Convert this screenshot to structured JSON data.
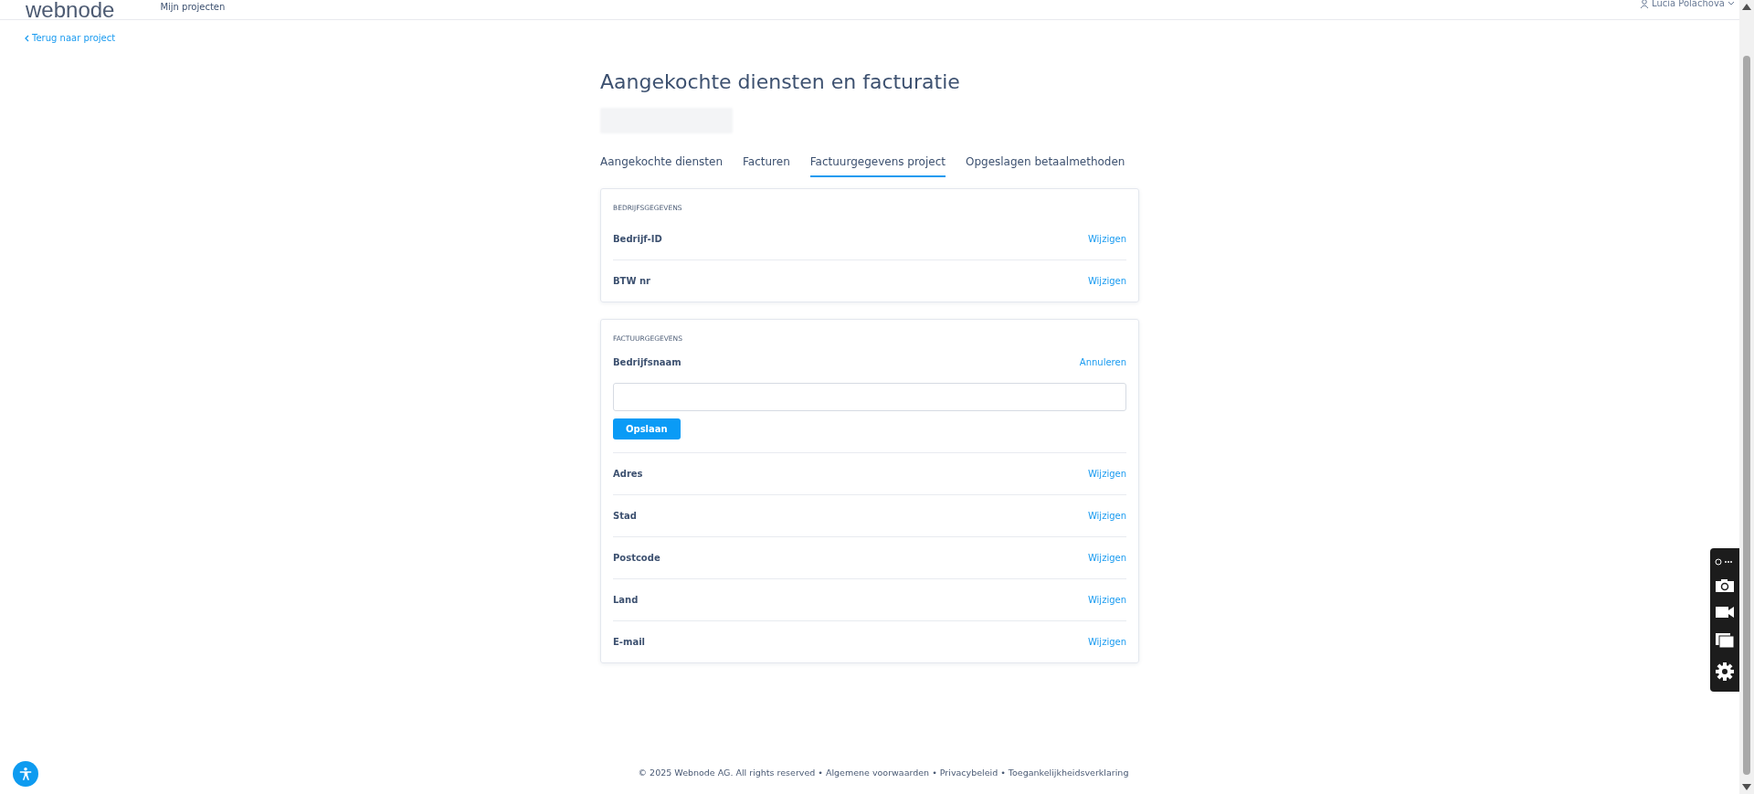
{
  "header": {
    "logo": "webnode",
    "nav": "Mijn projecten",
    "user": "Lucia Polachova"
  },
  "back_link": "Terug naar project",
  "title": "Aangekochte diensten en facturatie",
  "tabs": [
    {
      "label": "Aangekochte diensten",
      "selected": false
    },
    {
      "label": "Facturen",
      "selected": false
    },
    {
      "label": "Factuurgegevens project",
      "selected": true
    },
    {
      "label": "Opgeslagen betaalmethoden",
      "selected": false
    }
  ],
  "sections": [
    {
      "heading": "BEDRIJFSGEGEVENS",
      "rows": [
        {
          "kind": "row",
          "label": "Bedrijf-ID",
          "action": "Wijzigen"
        },
        {
          "kind": "row",
          "label": "BTW nr",
          "action": "Wijzigen"
        }
      ]
    },
    {
      "heading": "FACTUURGEGEVENS",
      "rows": [
        {
          "kind": "edit",
          "label": "Bedrijfsnaam",
          "action": "Annuleren",
          "button": "Opslaan"
        },
        {
          "kind": "row",
          "label": "Adres",
          "action": "Wijzigen"
        },
        {
          "kind": "row",
          "label": "Stad",
          "action": "Wijzigen"
        },
        {
          "kind": "row",
          "label": "Postcode",
          "action": "Wijzigen"
        },
        {
          "kind": "row",
          "label": "Land",
          "action": "Wijzigen"
        },
        {
          "kind": "row",
          "label": "E-mail",
          "action": "Wijzigen"
        }
      ]
    }
  ],
  "footer": "© 2025 Webnode AG. All rights reserved • Algemene voorwaarden • Privacybeleid • Toegankelijkheidsverklaring"
}
